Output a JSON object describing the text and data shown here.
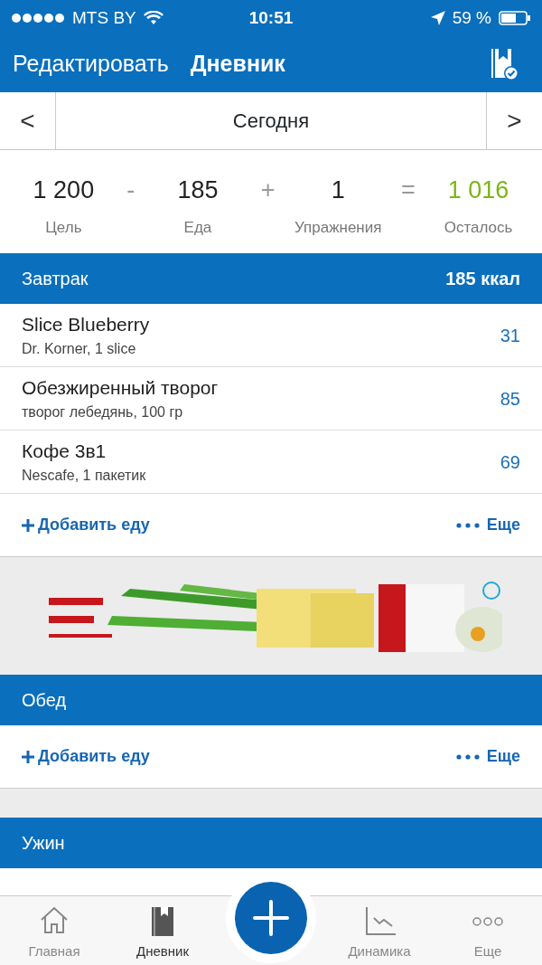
{
  "status_bar": {
    "carrier": "MTS BY",
    "time": "10:51",
    "battery": "59 %"
  },
  "nav": {
    "edit": "Редактировать",
    "title": "Дневник"
  },
  "date_bar": {
    "prev": "<",
    "label": "Сегодня",
    "next": ">"
  },
  "summary": [
    {
      "value": "1 200",
      "label": "Цель",
      "kind": "base"
    },
    {
      "op": "-"
    },
    {
      "value": "185",
      "label": "Еда",
      "kind": "base"
    },
    {
      "op": "+"
    },
    {
      "value": "1",
      "label": "Упражнения",
      "kind": "base"
    },
    {
      "op": "="
    },
    {
      "value": "1 016",
      "label": "Осталось",
      "kind": "result"
    }
  ],
  "meals": [
    {
      "name": "Завтрак",
      "kcal": "185 ккал",
      "items": [
        {
          "name": "Slice Blueberry",
          "detail": "Dr. Korner, 1 slice",
          "kcal": "31"
        },
        {
          "name": "Обезжиренный творог",
          "detail": "творог лебедянь, 100 гр",
          "kcal": "85"
        },
        {
          "name": "Кофе 3в1",
          "detail": "Nescafe, 1 пакетик",
          "kcal": "69"
        }
      ],
      "add": "Добавить еду",
      "more": "Еще"
    },
    {
      "name": "Обед",
      "add": "Добавить еду",
      "more": "Еще"
    },
    {
      "name": "Ужин"
    }
  ],
  "tab_bar": [
    {
      "label": "Главная",
      "kind": "home",
      "selected": false
    },
    {
      "label": "Дневник",
      "kind": "diary",
      "selected": true
    },
    {
      "kind": "add"
    },
    {
      "label": "Динамика",
      "kind": "chart",
      "selected": false
    },
    {
      "label": "Еще",
      "kind": "more",
      "selected": false
    }
  ]
}
